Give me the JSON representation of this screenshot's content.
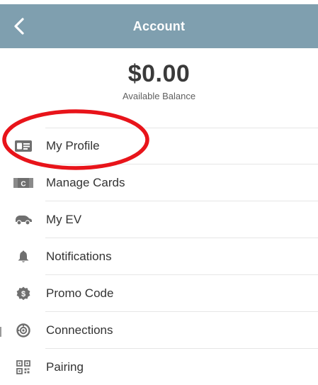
{
  "header": {
    "title": "Account",
    "back_icon": "chevron-left-icon",
    "background_color": "#7f9faf"
  },
  "balance": {
    "amount": "$0.00",
    "label": "Available Balance"
  },
  "menu": {
    "items": [
      {
        "label": "My Profile",
        "icon": "profile-card-icon"
      },
      {
        "label": "Manage Cards",
        "icon": "credit-card-icon"
      },
      {
        "label": "My EV",
        "icon": "car-icon"
      },
      {
        "label": "Notifications",
        "icon": "bell-icon"
      },
      {
        "label": "Promo Code",
        "icon": "promo-dollar-icon"
      },
      {
        "label": "Connections",
        "icon": "connections-icon"
      },
      {
        "label": "Pairing",
        "icon": "qr-code-icon"
      }
    ]
  },
  "annotation": {
    "shape": "ellipse",
    "color": "#e8141a",
    "highlights": "My Profile"
  },
  "colors": {
    "icon": "#6f6f6f",
    "text": "#333333",
    "divider": "#e6e6e6"
  }
}
